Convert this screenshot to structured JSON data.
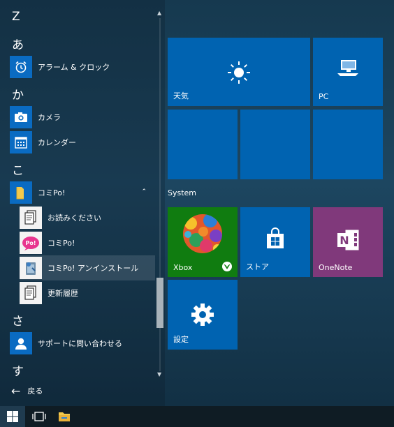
{
  "app_list": {
    "groups": [
      {
        "letter": "Z"
      },
      {
        "letter": "あ"
      },
      {
        "letter": "か"
      },
      {
        "letter": "こ"
      },
      {
        "letter": "さ"
      },
      {
        "letter": "す"
      }
    ],
    "items": [
      {
        "label": "アラーム & クロック",
        "icon": "alarm-clock-icon"
      },
      {
        "label": "カメラ",
        "icon": "camera-icon"
      },
      {
        "label": "カレンダー",
        "icon": "calendar-icon"
      },
      {
        "label": "コミPo!",
        "icon": "folder-icon"
      },
      {
        "label": "お読みください",
        "icon": "document-icon"
      },
      {
        "label": "コミPo!",
        "icon": "comipo-icon"
      },
      {
        "label": "コミPo! アンインストール",
        "icon": "uninstall-icon"
      },
      {
        "label": "更新履歴",
        "icon": "document-icon"
      },
      {
        "label": "サポートに問い合わせる",
        "icon": "support-person-icon"
      }
    ],
    "back_label": "戻る"
  },
  "tiles": {
    "weather": {
      "label": "天気",
      "icon": "sun-icon"
    },
    "pc": {
      "label": "PC",
      "icon": "computer-icon"
    },
    "group_label": "System",
    "xbox": {
      "label": "Xbox",
      "icon": "xbox-icon"
    },
    "store": {
      "label": "ストア",
      "icon": "store-bag-icon"
    },
    "onenote": {
      "label": "OneNote",
      "icon": "onenote-icon"
    },
    "settings": {
      "label": "設定",
      "icon": "gear-icon"
    }
  },
  "colors": {
    "tile_blue": "#0063b1",
    "xbox_green": "#107c10",
    "onenote_purple": "#80397b"
  },
  "taskbar": {
    "items": [
      "windows-start-icon",
      "task-view-icon",
      "file-explorer-icon"
    ]
  }
}
